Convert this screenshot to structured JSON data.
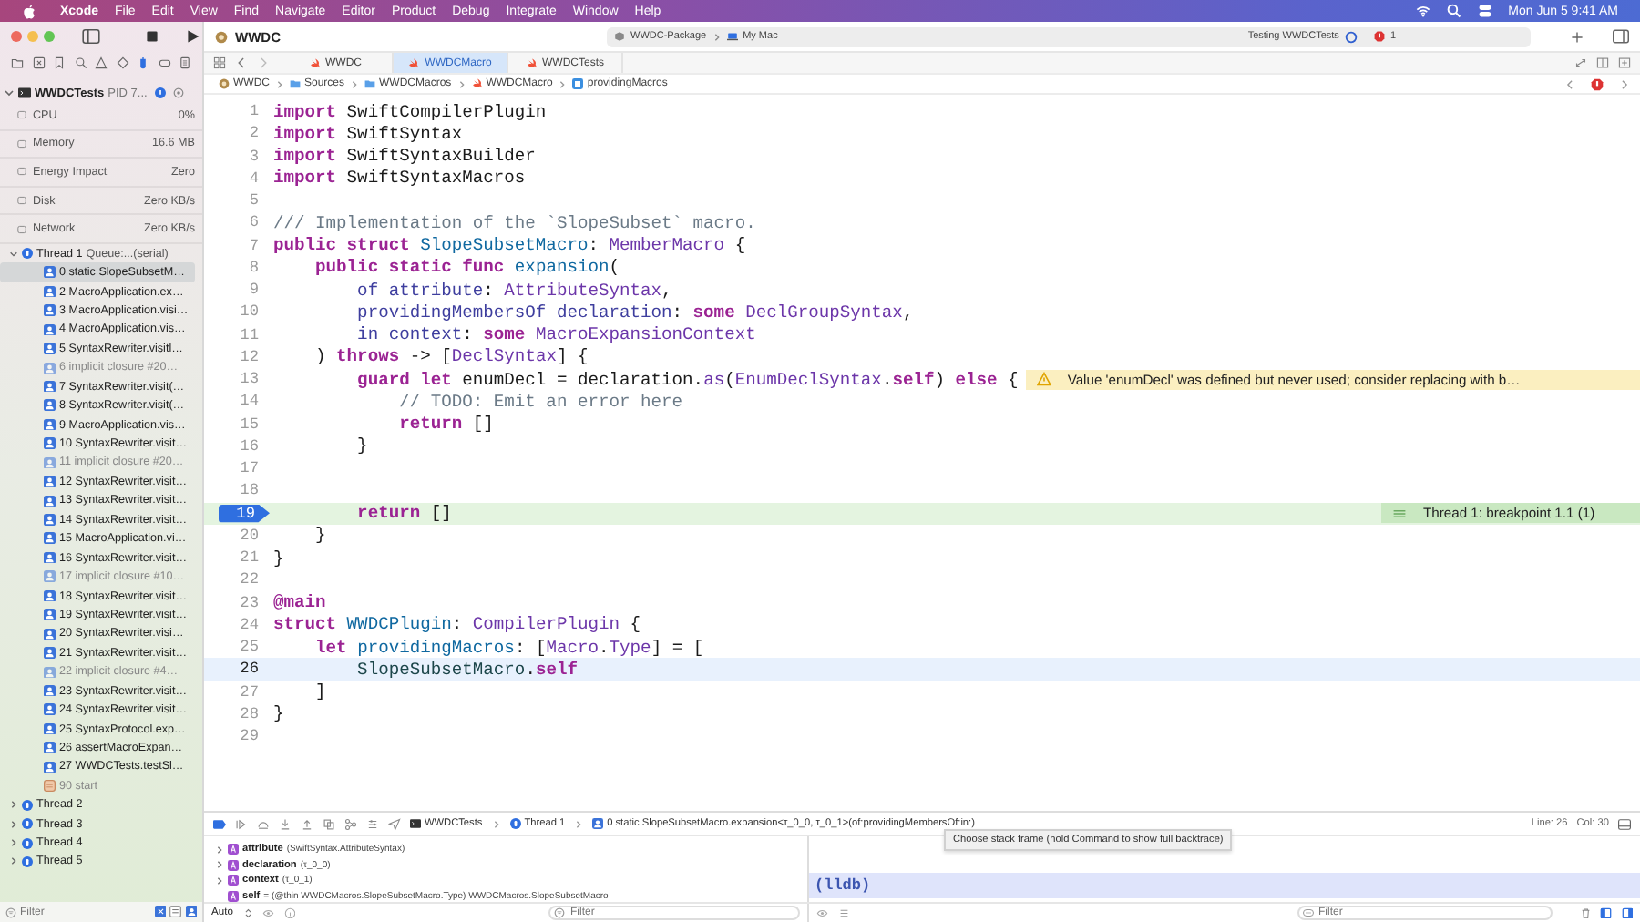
{
  "menu_bar": {
    "app": "Xcode",
    "items": [
      "File",
      "Edit",
      "View",
      "Find",
      "Navigate",
      "Editor",
      "Product",
      "Debug",
      "Integrate",
      "Window",
      "Help"
    ],
    "clock": "Mon Jun 5  9:41 AM"
  },
  "toolbar": {
    "project": "WWDC",
    "scheme": "WWDC-Package",
    "destination": "My Mac",
    "status": "Testing WWDCTests",
    "error_count": "1"
  },
  "tabs": [
    {
      "label": "WWDC",
      "selected": false
    },
    {
      "label": "WWDCMacro",
      "selected": true
    },
    {
      "label": "WWDCTests",
      "selected": false
    }
  ],
  "jump_bar": [
    {
      "text": "WWDC",
      "kind": "project"
    },
    {
      "text": "Sources",
      "kind": "folder"
    },
    {
      "text": "WWDCMacros",
      "kind": "folder"
    },
    {
      "text": "WWDCMacro",
      "kind": "swift"
    },
    {
      "text": "providingMacros",
      "kind": "property"
    }
  ],
  "navigator": {
    "process": {
      "name": "WWDCTests",
      "pid": "PID 7...",
      "expanded": true
    },
    "gauges": [
      {
        "label": "CPU",
        "value": "0%"
      },
      {
        "label": "Memory",
        "value": "16.6 MB"
      },
      {
        "label": "Energy Impact",
        "value": "Zero"
      },
      {
        "label": "Disk",
        "value": "Zero KB/s"
      },
      {
        "label": "Network",
        "value": "Zero KB/s"
      }
    ],
    "threads": [
      {
        "name": "Thread 1",
        "queue": "Queue:...(serial)",
        "expanded": true,
        "frames": [
          {
            "text": "0 static SlopeSubsetM…",
            "kind": "user",
            "selected": true
          },
          {
            "text": "2 MacroApplication.ex…",
            "kind": "user",
            "selected": false
          },
          {
            "text": "3 MacroApplication.visi…",
            "kind": "user",
            "selected": false
          },
          {
            "text": "4 MacroApplication.vis…",
            "kind": "user",
            "selected": false
          },
          {
            "text": "5 SyntaxRewriter.visitl…",
            "kind": "user",
            "selected": false
          },
          {
            "text": "6 implicit closure #20…",
            "kind": "implicit",
            "selected": false
          },
          {
            "text": "7 SyntaxRewriter.visit(…",
            "kind": "user",
            "selected": false
          },
          {
            "text": "8 SyntaxRewriter.visit(…",
            "kind": "user",
            "selected": false
          },
          {
            "text": "9 MacroApplication.vis…",
            "kind": "user",
            "selected": false
          },
          {
            "text": "10 SyntaxRewriter.visit…",
            "kind": "user",
            "selected": false
          },
          {
            "text": "11 implicit closure #20…",
            "kind": "implicit",
            "selected": false
          },
          {
            "text": "12 SyntaxRewriter.visit…",
            "kind": "user",
            "selected": false
          },
          {
            "text": "13 SyntaxRewriter.visit…",
            "kind": "user",
            "selected": false
          },
          {
            "text": "14 SyntaxRewriter.visit…",
            "kind": "user",
            "selected": false
          },
          {
            "text": "15 MacroApplication.vi…",
            "kind": "user",
            "selected": false
          },
          {
            "text": "16 SyntaxRewriter.visit…",
            "kind": "user",
            "selected": false
          },
          {
            "text": "17 implicit closure #10…",
            "kind": "implicit",
            "selected": false
          },
          {
            "text": "18 SyntaxRewriter.visit…",
            "kind": "user",
            "selected": false
          },
          {
            "text": "19 SyntaxRewriter.visit…",
            "kind": "user",
            "selected": false
          },
          {
            "text": "20 SyntaxRewriter.visi…",
            "kind": "user",
            "selected": false
          },
          {
            "text": "21 SyntaxRewriter.visit…",
            "kind": "user",
            "selected": false
          },
          {
            "text": "22 implicit closure #4…",
            "kind": "implicit",
            "selected": false
          },
          {
            "text": "23 SyntaxRewriter.visit…",
            "kind": "user",
            "selected": false
          },
          {
            "text": "24 SyntaxRewriter.visit…",
            "kind": "user",
            "selected": false
          },
          {
            "text": "25 SyntaxProtocol.exp…",
            "kind": "user",
            "selected": false
          },
          {
            "text": "26 assertMacroExpan…",
            "kind": "user",
            "selected": false
          },
          {
            "text": "27 WWDCTests.testSl…",
            "kind": "user",
            "selected": false
          },
          {
            "text": "90 start",
            "kind": "system",
            "selected": false
          }
        ]
      },
      {
        "name": "Thread 2",
        "expanded": false
      },
      {
        "name": "Thread 3",
        "expanded": false
      },
      {
        "name": "Thread 4",
        "expanded": false
      },
      {
        "name": "Thread 5",
        "expanded": false
      }
    ],
    "filter": {
      "placeholder": "Filter"
    }
  },
  "code": {
    "lines": [
      {
        "number": "1",
        "current": false,
        "stopped": false,
        "breakpoint": false,
        "tokens": [
          {
            "text": "import",
            "kind": "kw"
          },
          {
            "text": " SwiftCompilerPlugin",
            "kind": "plain"
          }
        ]
      },
      {
        "number": "2",
        "current": false,
        "stopped": false,
        "breakpoint": false,
        "tokens": [
          {
            "text": "import",
            "kind": "kw"
          },
          {
            "text": " SwiftSyntax",
            "kind": "plain"
          }
        ]
      },
      {
        "number": "3",
        "current": false,
        "stopped": false,
        "breakpoint": false,
        "tokens": [
          {
            "text": "import",
            "kind": "kw"
          },
          {
            "text": " SwiftSyntaxBuilder",
            "kind": "plain"
          }
        ]
      },
      {
        "number": "4",
        "current": false,
        "stopped": false,
        "breakpoint": false,
        "tokens": [
          {
            "text": "import",
            "kind": "kw"
          },
          {
            "text": " SwiftSyntaxMacros",
            "kind": "plain"
          }
        ]
      },
      {
        "number": "5",
        "current": false,
        "stopped": false,
        "breakpoint": false
      },
      {
        "number": "6",
        "current": false,
        "stopped": false,
        "breakpoint": false,
        "tokens": [
          {
            "text": "/// Implementation of the `SlopeSubset` macro.",
            "kind": "comment"
          }
        ]
      },
      {
        "number": "7",
        "current": false,
        "stopped": false,
        "breakpoint": false,
        "tokens": [
          {
            "text": "public struct",
            "kind": "kw"
          },
          {
            "text": " SlopeSubsetMacro",
            "kind": "decl"
          },
          {
            "text": ": ",
            "kind": "plain"
          },
          {
            "text": "MemberMacro",
            "kind": "type"
          },
          {
            "text": " {",
            "kind": "plain"
          }
        ]
      },
      {
        "number": "8",
        "current": false,
        "stopped": false,
        "breakpoint": false,
        "tokens": [
          {
            "text": "    public static func",
            "kind": "kw"
          },
          {
            "text": " expansion",
            "kind": "decl"
          },
          {
            "text": "(",
            "kind": "plain"
          }
        ]
      },
      {
        "number": "9",
        "current": false,
        "stopped": false,
        "breakpoint": false,
        "tokens": [
          {
            "text": "        of",
            "kind": "label"
          },
          {
            "text": " attribute",
            "kind": "label"
          },
          {
            "text": ": ",
            "kind": "plain"
          },
          {
            "text": "AttributeSyntax",
            "kind": "type"
          },
          {
            "text": ",",
            "kind": "plain"
          }
        ]
      },
      {
        "number": "10",
        "current": false,
        "stopped": false,
        "breakpoint": false,
        "tokens": [
          {
            "text": "        providingMembersOf",
            "kind": "label"
          },
          {
            "text": " declaration",
            "kind": "label"
          },
          {
            "text": ": ",
            "kind": "plain"
          },
          {
            "text": "some",
            "kind": "kw"
          },
          {
            "text": " DeclGroupSyntax",
            "kind": "type"
          },
          {
            "text": ",",
            "kind": "plain"
          }
        ]
      },
      {
        "number": "11",
        "current": false,
        "stopped": false,
        "breakpoint": false,
        "tokens": [
          {
            "text": "        in",
            "kind": "label"
          },
          {
            "text": " context",
            "kind": "label"
          },
          {
            "text": ": ",
            "kind": "plain"
          },
          {
            "text": "some",
            "kind": "kw"
          },
          {
            "text": " MacroExpansionContext",
            "kind": "type"
          }
        ]
      },
      {
        "number": "12",
        "current": false,
        "stopped": false,
        "breakpoint": false,
        "tokens": [
          {
            "text": "    ) ",
            "kind": "plain"
          },
          {
            "text": "throws",
            "kind": "kw"
          },
          {
            "text": " -> [",
            "kind": "plain"
          },
          {
            "text": "DeclSyntax",
            "kind": "type"
          },
          {
            "text": "] {",
            "kind": "plain"
          }
        ]
      },
      {
        "number": "13",
        "current": false,
        "stopped": false,
        "breakpoint": false,
        "tokens": [
          {
            "text": "        guard let",
            "kind": "kw"
          },
          {
            "text": " enumDecl = declaration.",
            "kind": "plain"
          },
          {
            "text": "as",
            "kind": "type"
          },
          {
            "text": "(",
            "kind": "plain"
          },
          {
            "text": "EnumDeclSyntax",
            "kind": "type"
          },
          {
            "text": ".",
            "kind": "plain"
          },
          {
            "text": "self",
            "kind": "kw"
          },
          {
            "text": ") ",
            "kind": "plain"
          },
          {
            "text": "else",
            "kind": "kw"
          },
          {
            "text": " {",
            "kind": "plain"
          }
        ],
        "annotation": {
          "kind": "warning",
          "text": "Value 'enumDecl' was defined but never used; consider replacing with b…"
        }
      },
      {
        "number": "14",
        "current": false,
        "stopped": false,
        "breakpoint": false,
        "tokens": [
          {
            "text": "            // TODO: Emit an error here",
            "kind": "comment"
          }
        ]
      },
      {
        "number": "15",
        "current": false,
        "stopped": false,
        "breakpoint": false,
        "tokens": [
          {
            "text": "            return",
            "kind": "kw"
          },
          {
            "text": " []",
            "kind": "plain"
          }
        ]
      },
      {
        "number": "16",
        "current": false,
        "stopped": false,
        "breakpoint": false,
        "tokens": [
          {
            "text": "        }",
            "kind": "plain"
          }
        ]
      },
      {
        "number": "17",
        "current": false,
        "stopped": false,
        "breakpoint": false
      },
      {
        "number": "18",
        "current": false,
        "stopped": false,
        "breakpoint": false
      },
      {
        "number": "19",
        "current": false,
        "stopped": true,
        "breakpoint": true,
        "tokens": [
          {
            "text": "        return",
            "kind": "kw"
          },
          {
            "text": " []",
            "kind": "plain"
          }
        ],
        "annotation": {
          "kind": "thread",
          "text": "Thread 1: breakpoint 1.1 (1)"
        }
      },
      {
        "number": "20",
        "current": false,
        "stopped": false,
        "breakpoint": false,
        "tokens": [
          {
            "text": "    }",
            "kind": "plain"
          }
        ]
      },
      {
        "number": "21",
        "current": false,
        "stopped": false,
        "breakpoint": false,
        "tokens": [
          {
            "text": "}",
            "kind": "plain"
          }
        ]
      },
      {
        "number": "22",
        "current": false,
        "stopped": false,
        "breakpoint": false
      },
      {
        "number": "23",
        "current": false,
        "stopped": false,
        "breakpoint": false,
        "tokens": [
          {
            "text": "@main",
            "kind": "kw"
          }
        ]
      },
      {
        "number": "24",
        "current": false,
        "stopped": false,
        "breakpoint": false,
        "tokens": [
          {
            "text": "struct",
            "kind": "kw"
          },
          {
            "text": " WWDCPlugin",
            "kind": "decl"
          },
          {
            "text": ": ",
            "kind": "plain"
          },
          {
            "text": "CompilerPlugin",
            "kind": "type"
          },
          {
            "text": " {",
            "kind": "plain"
          }
        ]
      },
      {
        "number": "25",
        "current": false,
        "stopped": false,
        "breakpoint": false,
        "tokens": [
          {
            "text": "    let",
            "kind": "kw"
          },
          {
            "text": " providingMacros",
            "kind": "decl"
          },
          {
            "text": ": [",
            "kind": "plain"
          },
          {
            "text": "Macro",
            "kind": "type"
          },
          {
            "text": ".",
            "kind": "plain"
          },
          {
            "text": "Type",
            "kind": "type"
          },
          {
            "text": "] = [",
            "kind": "plain"
          }
        ]
      },
      {
        "number": "26",
        "current": true,
        "stopped": false,
        "breakpoint": false,
        "tokens": [
          {
            "text": "        SlopeSubsetMacro",
            "kind": "proj"
          },
          {
            "text": ".",
            "kind": "plain"
          },
          {
            "text": "self",
            "kind": "kw"
          }
        ]
      },
      {
        "number": "27",
        "current": false,
        "stopped": false,
        "breakpoint": false,
        "tokens": [
          {
            "text": "    ]",
            "kind": "plain"
          }
        ]
      },
      {
        "number": "28",
        "current": false,
        "stopped": false,
        "breakpoint": false,
        "tokens": [
          {
            "text": "}",
            "kind": "plain"
          }
        ]
      },
      {
        "number": "29",
        "current": false,
        "stopped": false,
        "breakpoint": false
      }
    ]
  },
  "debug_bar": {
    "path": [
      {
        "text": "WWDCTests",
        "kind": "process"
      },
      {
        "text": "Thread 1",
        "kind": "thread"
      },
      {
        "text": "0 static SlopeSubsetMacro.expansion<τ_0_0, τ_0_1>(of:providingMembersOf:in:)",
        "kind": "frame"
      }
    ],
    "line": "Line: 26",
    "column": "Col: 30"
  },
  "tooltip": "Choose stack frame (hold Command to show full backtrace)",
  "variables": [
    {
      "name": "attribute",
      "detail": "(SwiftSyntax.AttributeSyntax)",
      "expandable": true
    },
    {
      "name": "declaration",
      "detail": "(τ_0_0)",
      "expandable": true
    },
    {
      "name": "context",
      "detail": "(τ_0_1)",
      "expandable": true
    },
    {
      "name": "self",
      "detail": "= (@thin WWDCMacros.SlopeSubsetMacro.Type) WWDCMacros.SlopeSubsetMacro",
      "expandable": false
    }
  ],
  "console": {
    "prompt": "(lldb)"
  },
  "bottom_bar": {
    "scope": "Auto",
    "variables_filter": {
      "placeholder": "Filter"
    },
    "console_filter": {
      "placeholder": "Filter"
    }
  }
}
